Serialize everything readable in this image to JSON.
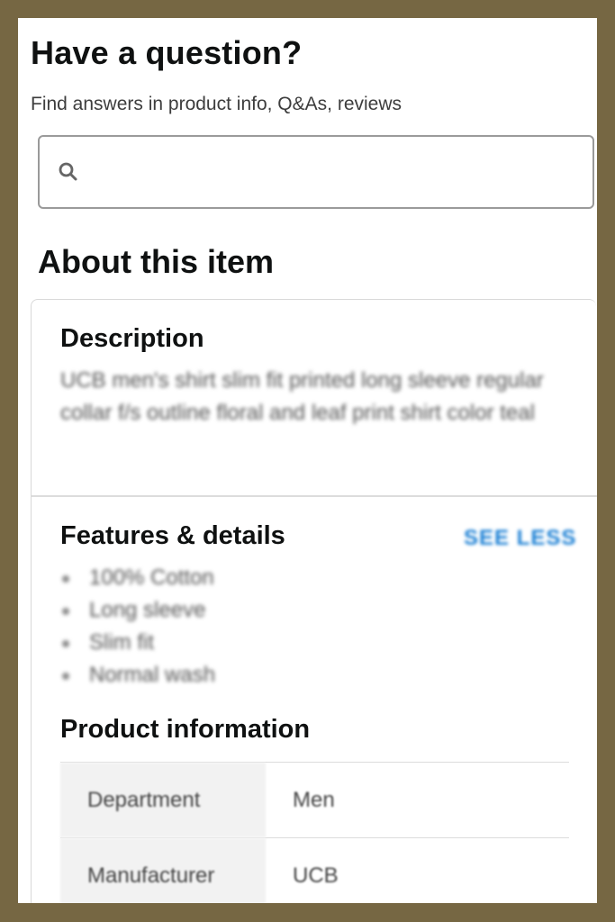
{
  "question": {
    "title": "Have a question?",
    "subtitle": "Find answers in product info, Q&As, reviews",
    "search_placeholder": ""
  },
  "about": {
    "title": "About this item",
    "description": {
      "heading": "Description",
      "text": "UCB men's shirt slim fit printed long sleeve regular collar f/s outline floral and leaf print shirt color teal"
    },
    "features": {
      "heading": "Features & details",
      "toggle_label": "SEE LESS",
      "items": [
        "100% Cotton",
        "Long sleeve",
        "Slim fit",
        "Normal wash"
      ]
    },
    "product_info": {
      "heading": "Product information",
      "rows": [
        {
          "key": "Department",
          "value": "Men"
        },
        {
          "key": "Manufacturer",
          "value": "UCB"
        }
      ]
    }
  },
  "colors": {
    "frame": "#766743",
    "link": "#1a7fd4",
    "table_key_bg": "#f2f2f2"
  },
  "icons": {
    "search": "search-icon"
  }
}
